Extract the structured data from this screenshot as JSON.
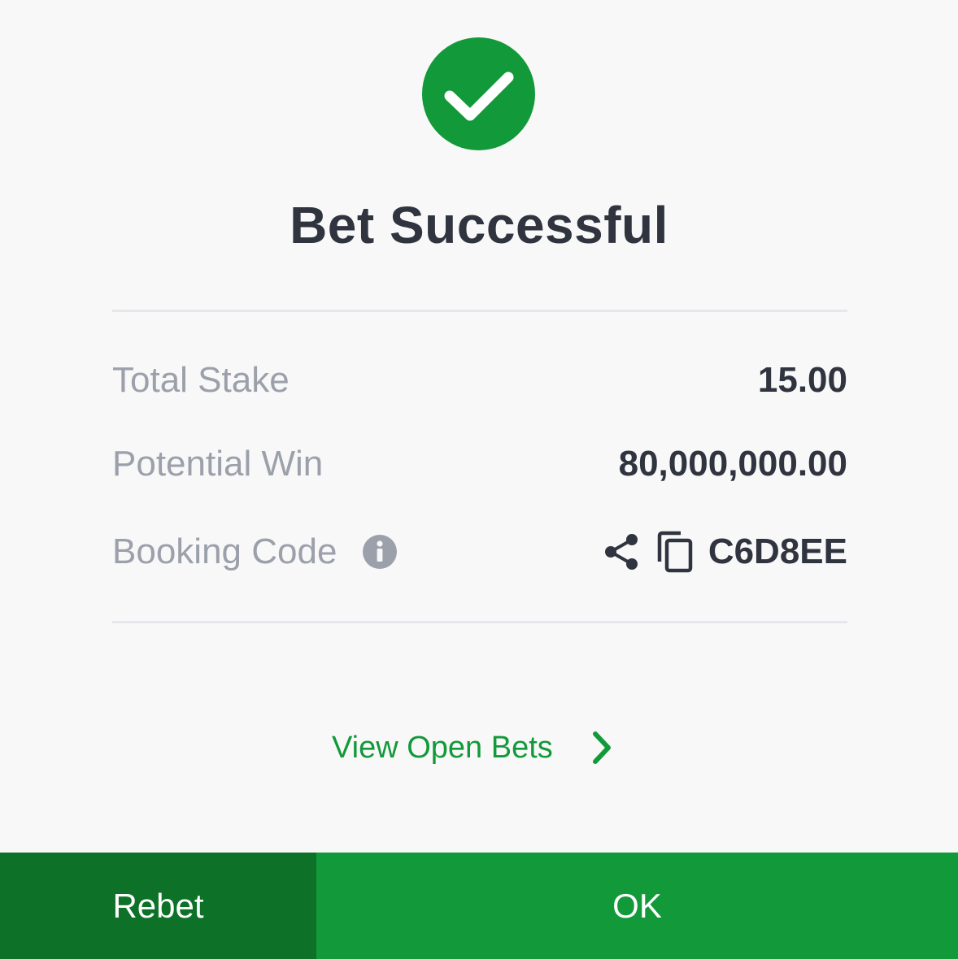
{
  "header": {
    "title": "Bet Successful",
    "icon": "checkmark-circle-icon"
  },
  "summary": {
    "total_stake": {
      "label": "Total Stake",
      "value": "15.00"
    },
    "potential_win": {
      "label": "Potential Win",
      "value": "80,000,000.00"
    },
    "booking_code": {
      "label": "Booking Code",
      "value": "C6D8EE",
      "icons": [
        "info-icon",
        "share-icon",
        "copy-icon"
      ]
    }
  },
  "links": {
    "view_open_bets": "View Open Bets"
  },
  "footer": {
    "rebet_label": "Rebet",
    "ok_label": "OK"
  },
  "colors": {
    "accent_green": "#12993a",
    "dark_green": "#0d7228",
    "text_dark": "#30343f",
    "text_muted": "#9ca0ab"
  }
}
